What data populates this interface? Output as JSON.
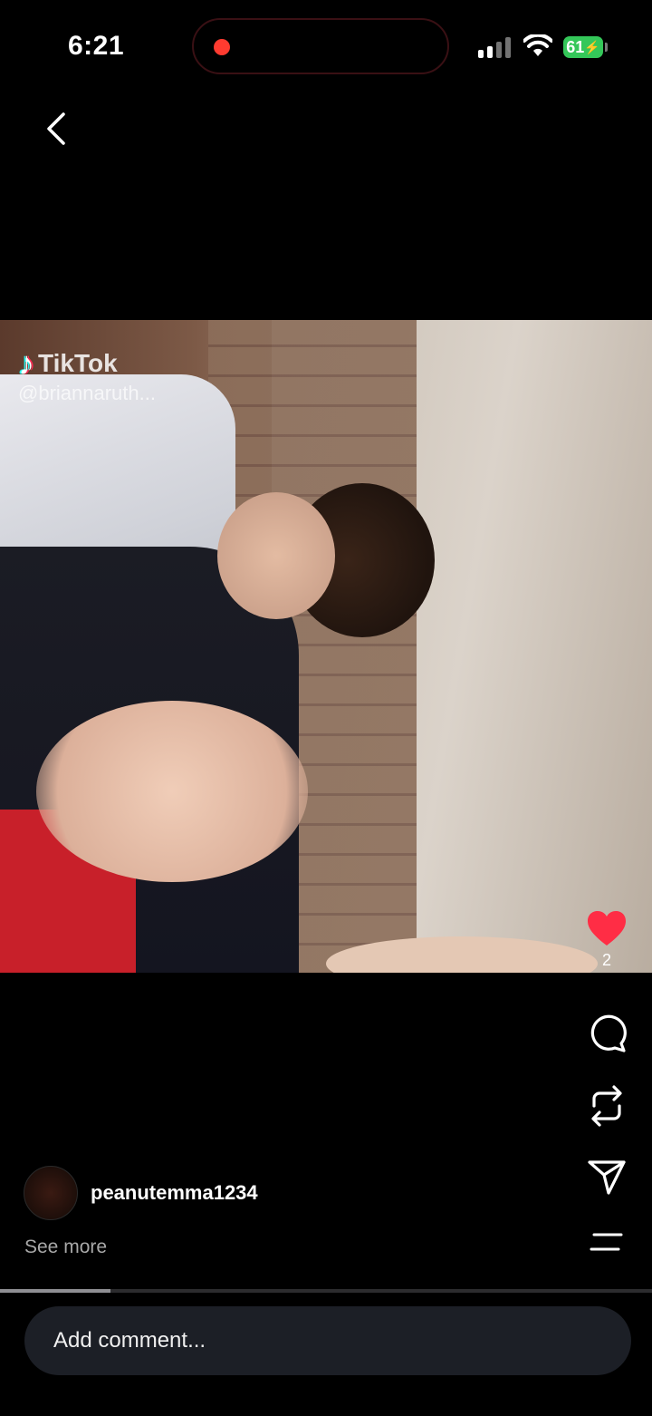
{
  "status_bar": {
    "time": "6:21",
    "battery": "61"
  },
  "video": {
    "watermark_app": "TikTok",
    "watermark_user": "@briannaruth..."
  },
  "actions": {
    "like_count": "2",
    "like_color": "#ff2d45"
  },
  "post": {
    "username": "peanutemma1234",
    "see_more": "See more"
  },
  "playback": {
    "progress": 0.17
  },
  "comment": {
    "placeholder": "Add comment..."
  },
  "icons": [
    "back-icon",
    "heart-icon",
    "comment-icon",
    "repost-icon",
    "send-icon",
    "menu-icon"
  ]
}
